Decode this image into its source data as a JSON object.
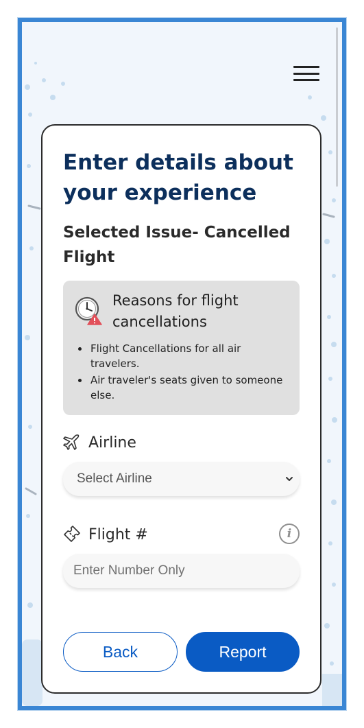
{
  "page": {
    "title": "Enter details about your experience",
    "issue": "Selected Issue- Cancelled Flight"
  },
  "info_box": {
    "icon": "clock-warning-icon",
    "heading": "Reasons for flight cancellations",
    "reasons": [
      "Flight Cancellations for all air travelers.",
      "Air traveler's seats given to someone else."
    ]
  },
  "airline_field": {
    "icon": "airplane-icon",
    "label": "Airline",
    "selected_value": "Select Airline"
  },
  "flight_field": {
    "icon": "ticket-icon",
    "label": "Flight #",
    "placeholder": "Enter Number Only",
    "value": "",
    "info_icon": "info-icon"
  },
  "actions": {
    "back_label": "Back",
    "report_label": "Report"
  },
  "colors": {
    "frame_border": "#3a86d4",
    "title": "#0c2f5c",
    "primary": "#0a5bc4",
    "info_box_bg": "#e0e0e0",
    "warning": "#e2505a"
  }
}
